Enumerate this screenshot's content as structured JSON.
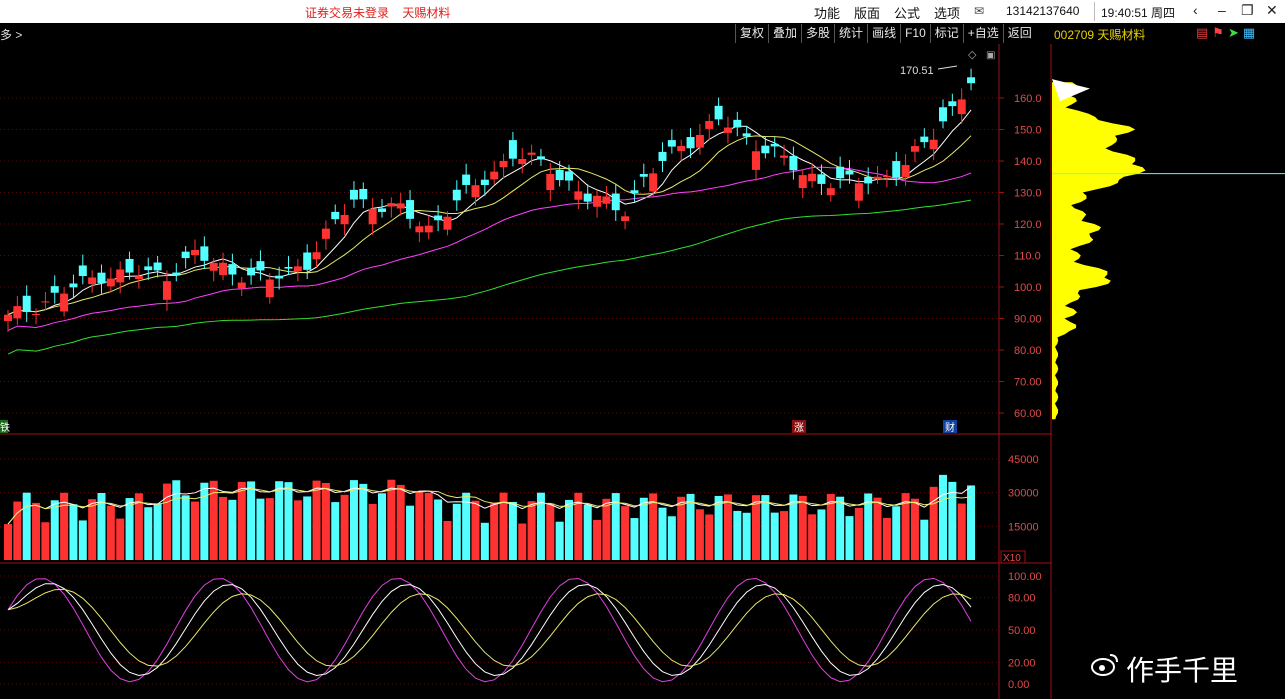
{
  "titlebar": {
    "warning": "证券交易未登录",
    "stock_name": "天赐材料",
    "menu": [
      "功能",
      "版面",
      "公式",
      "选项"
    ],
    "phone": "13142137640",
    "time": "19:40:51 周四"
  },
  "toolbar": {
    "left_label": "多 >",
    "buttons": [
      "复权",
      "叠加",
      "多股",
      "统计",
      "画线",
      "F10",
      "标记",
      "+自选",
      "返回"
    ],
    "stock_label": "002709 天赐材料"
  },
  "price_panel": {
    "peak_label": "170.51",
    "y_ticks": [
      "160.0",
      "150.0",
      "140.0",
      "130.0",
      "120.0",
      "110.0",
      "100.0",
      "90.00",
      "80.00",
      "70.00",
      "60.00"
    ],
    "markers": [
      "铁",
      "涨",
      "财"
    ]
  },
  "volume_panel": {
    "y_ticks": [
      "45000",
      "30000",
      "15000"
    ],
    "unit": "X10"
  },
  "kdj_panel": {
    "y_ticks": [
      "100.00",
      "80.00",
      "50.00",
      "20.00",
      "0.00"
    ]
  },
  "watermark": "作手千里",
  "colors": {
    "up": "#ff3232",
    "down": "#54ffff",
    "axis": "#a01010",
    "ma5": "#ffffff",
    "ma10": "#e8e86a",
    "ma20": "#ff40ff",
    "ma60": "#30e030",
    "profile": "#ffff00"
  }
}
